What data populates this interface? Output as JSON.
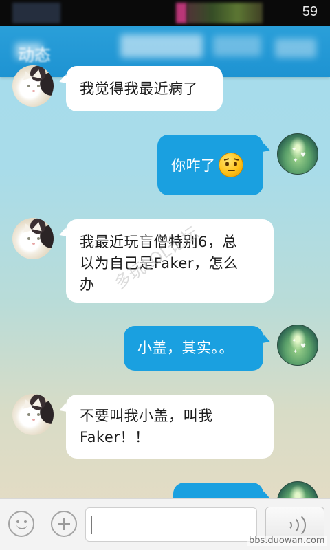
{
  "status_bar": {
    "time": "59"
  },
  "header": {
    "title": "动态"
  },
  "messages": [
    {
      "sender": "friend",
      "lines": [
        "我觉得我最近病了"
      ]
    },
    {
      "sender": "me",
      "lines": [
        "你咋了"
      ],
      "emoji": "worried-face-icon"
    },
    {
      "sender": "friend",
      "lines": [
        "我最近玩盲僧特别6，总",
        "以为自己是Faker，怎么",
        "办"
      ]
    },
    {
      "sender": "me",
      "lines": [
        "小盖，其实。。"
      ]
    },
    {
      "sender": "friend",
      "lines": [
        "不要叫我小盖，叫我",
        "Faker！！"
      ]
    },
    {
      "sender": "me",
      "lines": [
        ""
      ]
    }
  ],
  "watermark": "多玩LOL论坛",
  "site_watermark": "bbs.duowan.com",
  "input_bar": {
    "emoji_icon": "smile-icon",
    "plus_icon": "plus-icon",
    "text_value": "",
    "voice_icon": "voice-wave-icon"
  },
  "colors": {
    "accent": "#1aa0e0",
    "header": "#2298d5",
    "incoming_bubble": "#ffffff"
  }
}
